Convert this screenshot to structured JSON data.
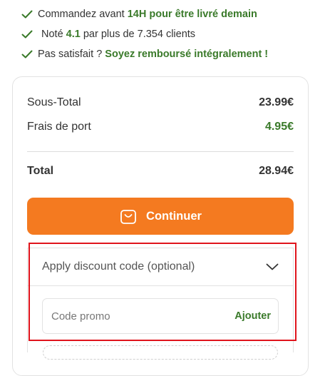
{
  "benefits": [
    {
      "prefix": "Commandez avant ",
      "highlight": "14H pour être livré demain"
    },
    {
      "prefix": "Noté ",
      "highlight": "4.1",
      "suffix": " par plus de 7.354 clients"
    },
    {
      "prefix": "Pas satisfait ? ",
      "highlight": "Soyez remboursé intégralement !"
    }
  ],
  "summary": {
    "subtotal_label": "Sous-Total",
    "subtotal_value": "23.99€",
    "shipping_label": "Frais de port",
    "shipping_value": "4.95€",
    "total_label": "Total",
    "total_value": "28.94€",
    "continue_label": "Continuer"
  },
  "discount": {
    "toggle_label": "Apply discount code (optional)",
    "promo_placeholder": "Code promo",
    "promo_value": "",
    "add_label": "Ajouter"
  },
  "colors": {
    "accent_orange": "#f47a20",
    "accent_green": "#3a7a2a",
    "highlight_red": "#e0141c"
  },
  "icons": [
    "check-icon",
    "shopping-bag-icon",
    "chevron-down-icon"
  ]
}
